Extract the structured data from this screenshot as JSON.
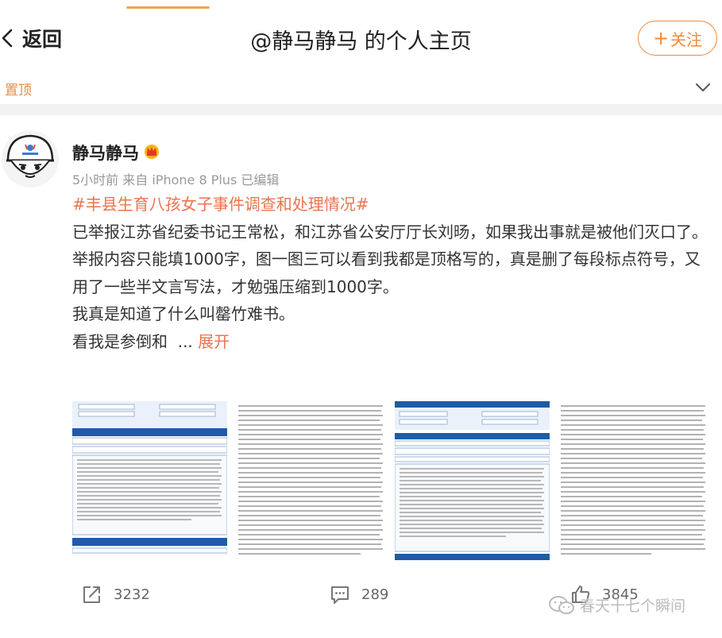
{
  "header": {
    "back_label": "返回",
    "title": "@静马静马 的个人主页",
    "follow_label": "关注",
    "follow_plus": "+"
  },
  "pinned": {
    "label": "置顶"
  },
  "post": {
    "username": "静马静马",
    "meta": "5小时前 来自 iPhone 8 Plus 已编辑",
    "hashtag": "#丰县生育八孩女子事件调查和处理情况#",
    "paragraphs": [
      "已举报江苏省纪委书记王常松，和江苏省公安厅厅长刘旸，如果我出事就是被他们灭口了。",
      "举报内容只能填1000字，图一图三可以看到我都是顶格写的，真是删了每段标点符号，又用了一些半文言写法，才勉强压缩到1000字。",
      "我真是知道了什么叫罄竹难书。"
    ],
    "truncated_text": "看我是参倒和",
    "ellipsis": "...",
    "expand_label": "展开",
    "avatar_icon": "helmet-avatar-icon",
    "badge_icon": "crown-badge-icon"
  },
  "actions": {
    "share_count": "3232",
    "comment_count": "289",
    "like_count": "3845"
  },
  "watermark": {
    "text": "春天十七个瞬间"
  },
  "colors": {
    "accent_orange": "#f08a3c",
    "hashtag_orange": "#eb7350",
    "separator_gray": "#f2f2f2",
    "meta_gray": "#999999",
    "form_blue": "#1c5ca8"
  }
}
